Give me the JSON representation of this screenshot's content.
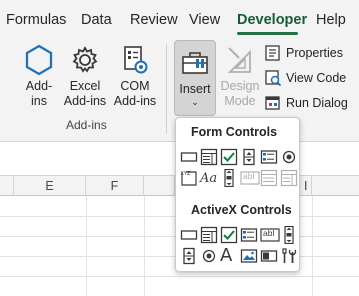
{
  "tabs": [
    {
      "label": "Formulas",
      "active": false
    },
    {
      "label": "Data",
      "active": false
    },
    {
      "label": "Review",
      "active": false
    },
    {
      "label": "View",
      "active": false
    },
    {
      "label": "Developer",
      "active": true
    },
    {
      "label": "Help",
      "active": false
    }
  ],
  "ribbon": {
    "addins_group": {
      "label": "Add-ins",
      "buttons": [
        {
          "line1": "Add-",
          "line2": "ins",
          "icon": "add-ins-hexagon-icon"
        },
        {
          "line1": "Excel",
          "line2": "Add-ins",
          "icon": "gear-icon"
        },
        {
          "line1": "COM",
          "line2": "Add-ins",
          "icon": "com-addins-icon"
        }
      ]
    },
    "controls_group": {
      "insert": {
        "label": "Insert",
        "chevron": "⌄",
        "icon": "toolbox-icon"
      },
      "design_mode": {
        "line1": "Design",
        "line2": "Mode",
        "enabled": false,
        "icon": "design-mode-icon"
      },
      "properties": {
        "label": "Properties",
        "icon": "properties-icon"
      },
      "view_code": {
        "label": "View Code",
        "icon": "view-code-icon"
      },
      "run_dialog": {
        "label": "Run Dialog",
        "icon": "run-dialog-icon"
      }
    }
  },
  "sheet": {
    "columns": [
      "E",
      "F",
      "",
      "I"
    ]
  },
  "insert_menu": {
    "form_controls": {
      "title": "Form Controls",
      "items": [
        {
          "name": "button",
          "enabled": true
        },
        {
          "name": "combo-box",
          "enabled": true
        },
        {
          "name": "check-box",
          "enabled": true
        },
        {
          "name": "spin-button",
          "enabled": true
        },
        {
          "name": "list-box",
          "enabled": true
        },
        {
          "name": "option-button",
          "enabled": true
        },
        {
          "name": "group-box",
          "enabled": true
        },
        {
          "name": "label",
          "enabled": true
        },
        {
          "name": "scroll-bar",
          "enabled": true
        },
        {
          "name": "text-field",
          "enabled": false
        },
        {
          "name": "combo-list-edit",
          "enabled": false
        },
        {
          "name": "combo-drop-down-edit",
          "enabled": false
        }
      ],
      "label_glyph": "Aa",
      "textfield_glyph": "abl"
    },
    "activex_controls": {
      "title": "ActiveX Controls",
      "items": [
        {
          "name": "command-button",
          "enabled": true
        },
        {
          "name": "combo-box",
          "enabled": true
        },
        {
          "name": "check-box",
          "enabled": true
        },
        {
          "name": "list-box",
          "enabled": true
        },
        {
          "name": "text-box",
          "enabled": true
        },
        {
          "name": "scroll-bar",
          "enabled": true
        },
        {
          "name": "spin-button",
          "enabled": true
        },
        {
          "name": "option-button",
          "enabled": true
        },
        {
          "name": "label",
          "enabled": true
        },
        {
          "name": "image",
          "enabled": true
        },
        {
          "name": "toggle-button",
          "enabled": true
        },
        {
          "name": "more-controls",
          "enabled": true
        }
      ],
      "label_glyph": "A",
      "textbox_glyph": "abl"
    }
  },
  "colors": {
    "accent": "#217346",
    "active_tab_text": "#185c37",
    "icon_blue": "#1f6fb5",
    "check_green": "#107c41",
    "disabled": "#b0b0b0"
  }
}
